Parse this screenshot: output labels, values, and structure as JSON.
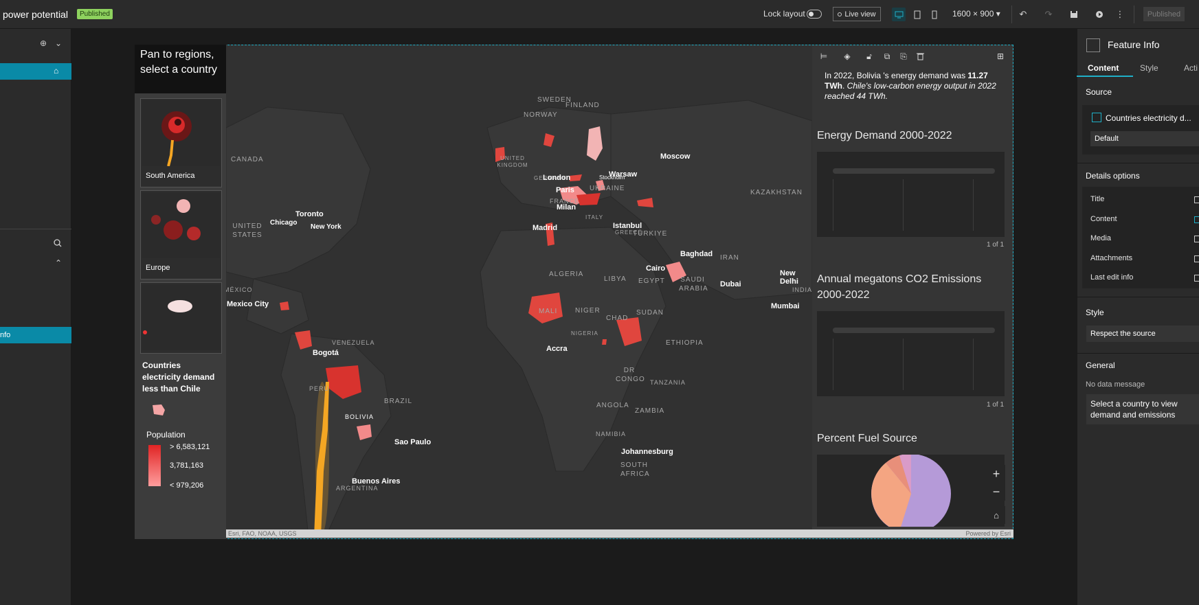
{
  "app": {
    "title": "power potential",
    "status_badge": "Published"
  },
  "toolbar": {
    "lock_layout_label": "Lock layout",
    "live_view_label": "Live view",
    "screen_size": "1600 × 900",
    "published_label": "Published"
  },
  "left_panel": {
    "highlight_label": "nfo"
  },
  "map_panel": {
    "title": "Pan to regions, select a country",
    "bookmarks": [
      {
        "label": "South America"
      },
      {
        "label": "Europe"
      },
      {
        "label": ""
      }
    ],
    "legend": {
      "title": "Countries electricity demand less than Chile",
      "population_label": "Population",
      "ramp_values": [
        "> 6,583,121",
        "3,781,163",
        "< 979,206"
      ]
    },
    "region_labels": [
      "SWEDEN",
      "FINLAND",
      "NORWAY",
      "UNITED KINGDOM",
      "GERMANY",
      "FRANCE",
      "ITALY",
      "UKRAINE",
      "KAZAKHSTAN",
      "CANADA",
      "UNITED STATES",
      "TÜRKIYE",
      "GREECE",
      "IRAN",
      "ALGERIA",
      "LIBYA",
      "EGYPT",
      "SAUDI ARABIA",
      "MALI",
      "NIGER",
      "CHAD",
      "SUDAN",
      "NIGERIA",
      "ETHIOPIA",
      "DR CONGO",
      "TANZANIA",
      "ANGOLA",
      "ZAMBIA",
      "NAMIBIA",
      "SOUTH AFRICA",
      "VENEZUELA",
      "PERÚ",
      "BRAZIL",
      "BOLIVIA",
      "ARGENTINA",
      "MÉXICO",
      "INDIA"
    ],
    "cities": [
      "Stockholm",
      "Moscow",
      "London",
      "Warsaw",
      "Paris",
      "Milan",
      "Madrid",
      "Istanbul",
      "Baghdad",
      "Toronto",
      "Chicago",
      "New York",
      "Cairo",
      "Dubai",
      "New Delhi",
      "Mumbai",
      "Mexico City",
      "Bogotá",
      "Accra",
      "Johannesburg",
      "Sao Paulo",
      "Buenos Aires"
    ],
    "attribution": "Esri, FAO, NOAA, USGS",
    "powered_by": "Powered by Esri"
  },
  "feature_info": {
    "summary_prefix": "In 2022, Bolivia 's energy demand was ",
    "summary_value": "11.27 TWh",
    "summary_suffix": ". ",
    "summary_italic": "Chile's low-carbon energy output in 2022 reached 44 TWh.",
    "section1_title": "Energy Demand 2000-2022",
    "section1_pager": "1 of 1",
    "section2_title": "Annual megatons CO2 Emissions 2000-2022",
    "section2_pager": "1 of 1",
    "section3_title": "Percent Fuel Source"
  },
  "settings_panel": {
    "title": "Feature Info",
    "tabs": [
      "Content",
      "Style",
      "Acti"
    ],
    "source_label": "Source",
    "source_value": "Countries electricity d...",
    "source_view": "Default",
    "details_label": "Details options",
    "details_rows": [
      {
        "label": "Title",
        "checked": false
      },
      {
        "label": "Content",
        "checked": true
      },
      {
        "label": "Media",
        "checked": true
      },
      {
        "label": "Attachments",
        "checked": true
      },
      {
        "label": "Last edit info",
        "checked": true
      }
    ],
    "style_label": "Style",
    "style_value": "Respect the source",
    "general_label": "General",
    "no_data_label": "No data message",
    "no_data_value": "Select a country to view demand and emissions"
  },
  "colors": {
    "accent": "#1fb0c8",
    "map_highlight": "#e8403a",
    "chile": "#f5a623",
    "pie_main": "#b59ad8",
    "pie_second": "#f4a582"
  }
}
